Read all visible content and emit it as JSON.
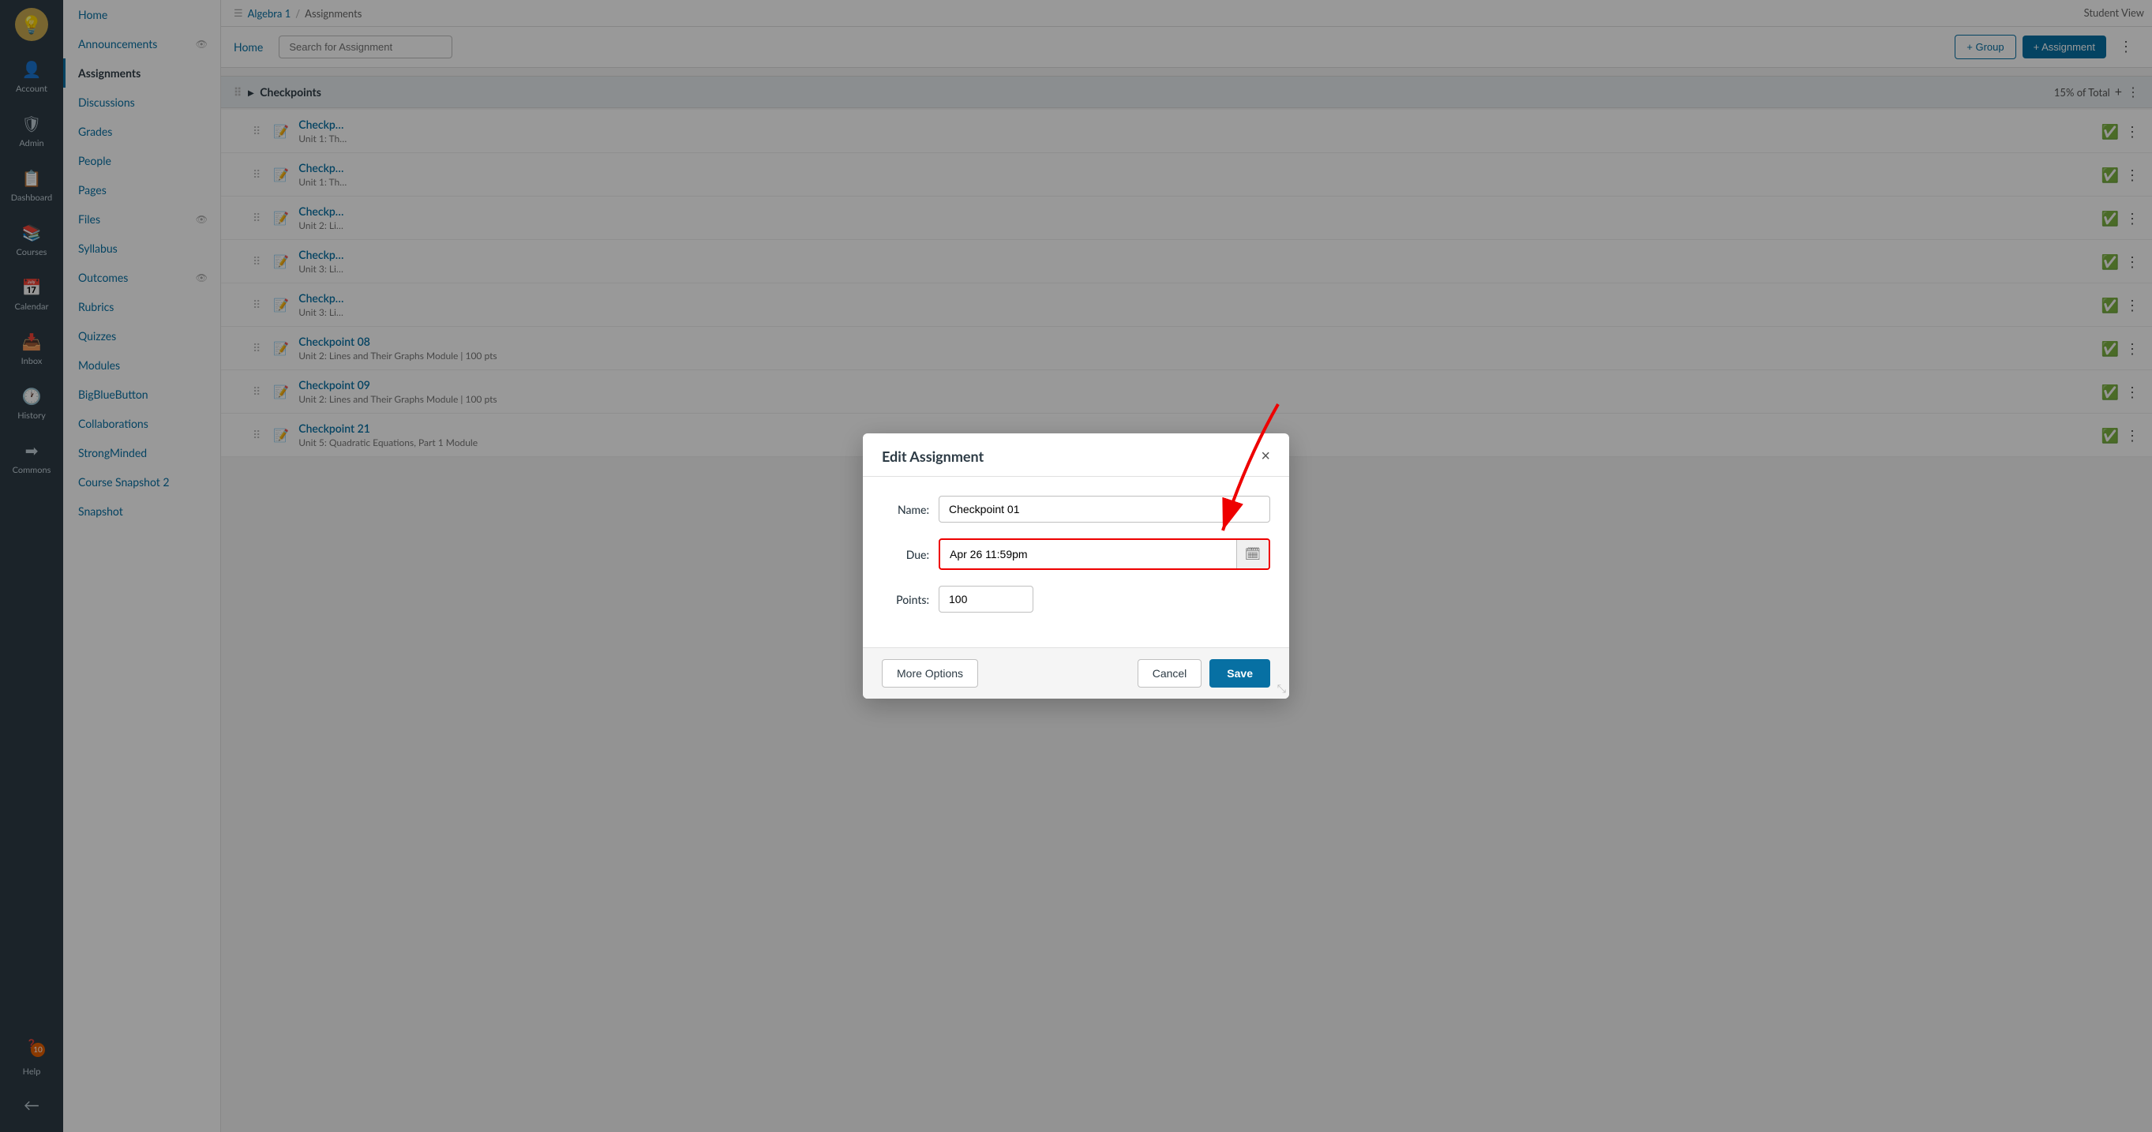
{
  "globalNav": {
    "logo": "💡",
    "items": [
      {
        "id": "account",
        "icon": "👤",
        "label": "Account"
      },
      {
        "id": "admin",
        "icon": "🛡",
        "label": "Admin"
      },
      {
        "id": "dashboard",
        "icon": "📋",
        "label": "Dashboard"
      },
      {
        "id": "courses",
        "icon": "📚",
        "label": "Courses"
      },
      {
        "id": "calendar",
        "icon": "📅",
        "label": "Calendar"
      },
      {
        "id": "inbox",
        "icon": "📥",
        "label": "Inbox"
      },
      {
        "id": "history",
        "icon": "🕐",
        "label": "History"
      },
      {
        "id": "commons",
        "icon": "➡",
        "label": "Commons"
      },
      {
        "id": "help",
        "icon": "❓",
        "label": "Help",
        "badge": "10"
      }
    ],
    "collapseLabel": "←"
  },
  "courseNav": {
    "items": [
      {
        "id": "home",
        "label": "Home",
        "active": false
      },
      {
        "id": "announcements",
        "label": "Announcements",
        "hasEye": true,
        "active": false
      },
      {
        "id": "assignments",
        "label": "Assignments",
        "active": true
      },
      {
        "id": "discussions",
        "label": "Discussions",
        "active": false
      },
      {
        "id": "grades",
        "label": "Grades",
        "active": false
      },
      {
        "id": "people",
        "label": "People",
        "active": false
      },
      {
        "id": "pages",
        "label": "Pages",
        "active": false
      },
      {
        "id": "files",
        "label": "Files",
        "hasEye": true,
        "active": false
      },
      {
        "id": "syllabus",
        "label": "Syllabus",
        "active": false
      },
      {
        "id": "outcomes",
        "label": "Outcomes",
        "hasEye": true,
        "active": false
      },
      {
        "id": "rubrics",
        "label": "Rubrics",
        "active": false
      },
      {
        "id": "quizzes",
        "label": "Quizzes",
        "active": false
      },
      {
        "id": "modules",
        "label": "Modules",
        "active": false
      },
      {
        "id": "bigbluebutton",
        "label": "BigBlueButton",
        "active": false
      },
      {
        "id": "collaborations",
        "label": "Collaborations",
        "active": false
      },
      {
        "id": "strongminded",
        "label": "StrongMinded",
        "active": false
      },
      {
        "id": "coursesnapshot2",
        "label": "Course Snapshot 2",
        "active": false
      },
      {
        "id": "snapshot",
        "label": "Snapshot",
        "active": false
      }
    ]
  },
  "breadcrumb": {
    "items": [
      "Algebra 1",
      "Assignments"
    ]
  },
  "toolbar": {
    "homeLabel": "Home",
    "searchPlaceholder": "Search for Assignment",
    "addGroupLabel": "+ Group",
    "addAssignmentLabel": "+ Assignment"
  },
  "assignmentGroup": {
    "name": "Checkpoints",
    "percent": "15% of Total"
  },
  "assignments": [
    {
      "id": 1,
      "name": "Checkp…",
      "meta": "Unit 1: Th…"
    },
    {
      "id": 2,
      "name": "Checkp…",
      "meta": "Unit 1: Th…"
    },
    {
      "id": 3,
      "name": "Checkp…",
      "meta": "Unit 2: Li…"
    },
    {
      "id": 4,
      "name": "Checkp…",
      "meta": "Unit 3: Li…"
    },
    {
      "id": 5,
      "name": "Checkp…",
      "meta": "Unit 3: Li…"
    },
    {
      "id": 6,
      "name": "Checkpoint 08",
      "meta": "Unit 2: Lines and Their Graphs Module  |  100 pts"
    },
    {
      "id": 7,
      "name": "Checkpoint 09",
      "meta": "Unit 2: Lines and Their Graphs Module  |  100 pts"
    },
    {
      "id": 8,
      "name": "Checkpoint 21",
      "meta": "Unit 5: Quadratic Equations, Part 1 Module"
    }
  ],
  "modal": {
    "title": "Edit Assignment",
    "closeLabel": "×",
    "nameLabel": "Name:",
    "nameValue": "Checkpoint 01",
    "dueLabel": "Due:",
    "dueValue": "Apr 26 11:59pm",
    "pointsLabel": "Points:",
    "pointsValue": "100",
    "moreOptionsLabel": "More Options",
    "cancelLabel": "Cancel",
    "saveLabel": "Save"
  },
  "studentViewLabel": "Student View"
}
